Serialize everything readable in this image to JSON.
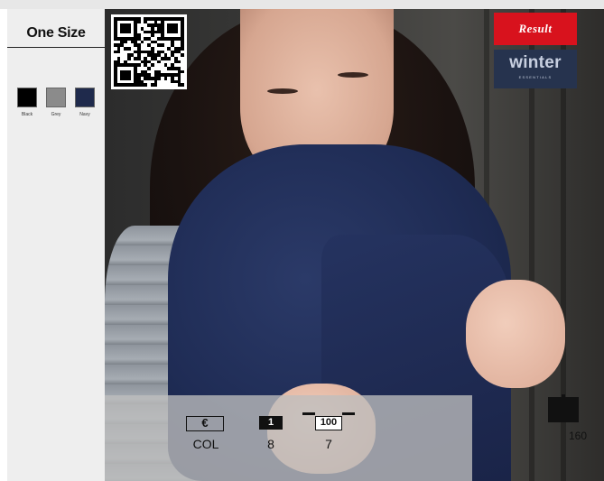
{
  "size": {
    "title": "One Size"
  },
  "colours": [
    {
      "label": "Black",
      "hex": "#000000"
    },
    {
      "label": "Grey",
      "hex": "#8b8b8b"
    },
    {
      "label": "Navy",
      "hex": "#1f2a4c"
    }
  ],
  "brands": {
    "result": "Result",
    "winter_line1": "winter",
    "winter_line2": "ESSENTIALS"
  },
  "icons": [
    "qr-code-icon",
    "euro-icon",
    "pack-quantity-icon",
    "carton-quantity-icon",
    "carton-box-icon"
  ],
  "info": {
    "currency_symbol": "€",
    "currency_label": "COL",
    "pack_box": "1",
    "pack_value": "8",
    "carton_box": "100",
    "carton_value": "7",
    "box_value": "160"
  },
  "colors": {
    "accent_red": "#d8121d",
    "brand_navy": "#26334e",
    "sidebar_bg": "#eeeeee"
  }
}
